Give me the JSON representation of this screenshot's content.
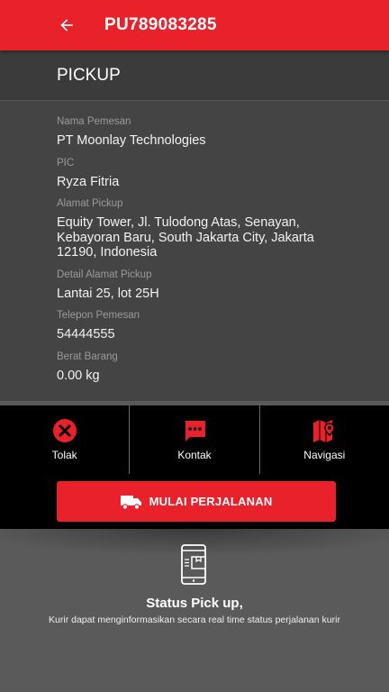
{
  "header": {
    "title": "PU789083285",
    "back_icon": "arrow-left-icon"
  },
  "section": {
    "title": "PICKUP"
  },
  "details": {
    "order_name_label": "Nama Pemesan",
    "order_name_value": "PT Moonlay Technologies",
    "pic_label": "PIC",
    "pic_value": "Ryza Fitria",
    "address_label": "Alamat Pickup",
    "address_value": "Equity Tower, Jl. Tulodong Atas, Senayan, Kebayoran Baru, South Jakarta City, Jakarta 12190, Indonesia",
    "address_detail_label": "Detail Alamat Pickup",
    "address_detail_value": "Lantai 25, lot 25H",
    "phone_label": "Telepon Pemesan",
    "phone_value": "54444555",
    "weight_label": "Berat Barang",
    "weight_value": "0.00 kg"
  },
  "actions": {
    "reject_label": "Tolak",
    "contact_label": "Kontak",
    "navigate_label": "Navigasi"
  },
  "start_button": {
    "label": "MULAI PERJALANAN",
    "icon": "truck-icon"
  },
  "promo": {
    "title": "Status Pick up,",
    "subtitle": "Kurir dapat menginformasikan secara real time status perjalanan kurir",
    "icon": "phone-package-icon"
  },
  "colors": {
    "accent": "#e8212b",
    "dark": "#000000",
    "panel": "#444444"
  }
}
